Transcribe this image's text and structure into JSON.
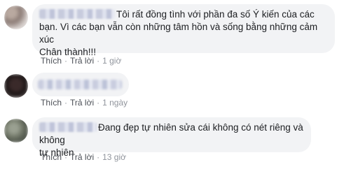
{
  "comments": [
    {
      "text_line1": "Tôi rất đồng tình với phần đa số Ý kiến của các",
      "text_line2": "bạn. Vì các bạn vẫn còn những tâm hồn và sống bằng những cảm xúc",
      "text_line3": "Chân thành!!!",
      "like_label": "Thích",
      "reply_label": "Trả lời",
      "time": "1 giờ"
    },
    {
      "like_label": "Thích",
      "reply_label": "Trả lời",
      "time": "1 ngày"
    },
    {
      "text_line1": "Đang đẹp tự nhiên sửa cái không có nét riêng và không",
      "text_line2": "tự nhiên",
      "like_label": "Thích",
      "reply_label": "Trả lời",
      "time": "13 giờ"
    }
  ],
  "colors": {
    "bubble_bg": "#f2f3f5",
    "text": "#1c1e21",
    "meta": "#90949c"
  }
}
